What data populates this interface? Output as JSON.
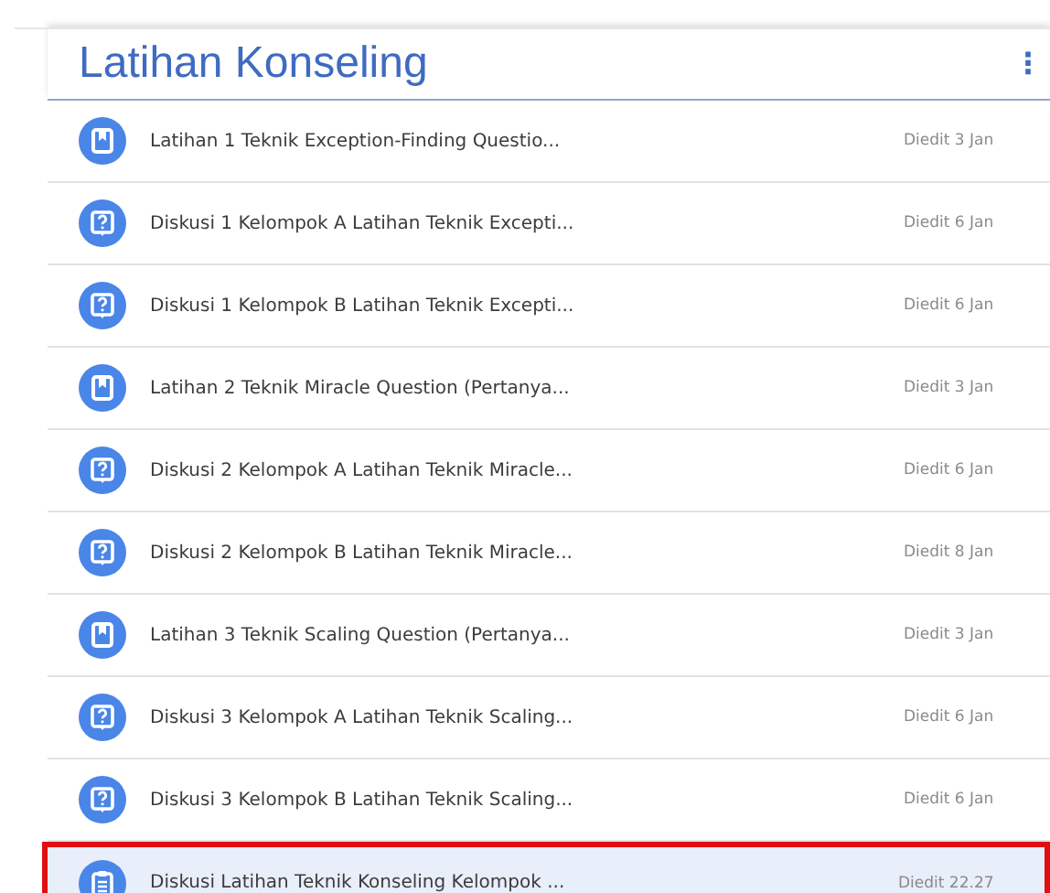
{
  "topic": {
    "title": "Latihan Konseling",
    "menu_icon": "⋮"
  },
  "items": [
    {
      "kind": "assignment",
      "title": "Latihan 1 Teknik Exception-Finding Questio...",
      "edited": "Diedit 3 Jan",
      "selected": false
    },
    {
      "kind": "question",
      "title": "Diskusi 1 Kelompok A Latihan Teknik Excepti...",
      "edited": "Diedit 6 Jan",
      "selected": false
    },
    {
      "kind": "question",
      "title": "Diskusi 1 Kelompok B Latihan Teknik Excepti...",
      "edited": "Diedit 6 Jan",
      "selected": false
    },
    {
      "kind": "assignment",
      "title": "Latihan 2 Teknik Miracle Question (Pertanya...",
      "edited": "Diedit 3 Jan",
      "selected": false
    },
    {
      "kind": "question",
      "title": "Diskusi 2 Kelompok A Latihan Teknik Miracle...",
      "edited": "Diedit 6 Jan",
      "selected": false
    },
    {
      "kind": "question",
      "title": "Diskusi 2 Kelompok B Latihan Teknik Miracle...",
      "edited": "Diedit 8 Jan",
      "selected": false
    },
    {
      "kind": "assignment",
      "title": "Latihan 3 Teknik Scaling Question (Pertanya...",
      "edited": "Diedit 3 Jan",
      "selected": false
    },
    {
      "kind": "question",
      "title": "Diskusi 3 Kelompok A Latihan Teknik Scaling...",
      "edited": "Diedit 6 Jan",
      "selected": false
    },
    {
      "kind": "question",
      "title": "Diskusi 3 Kelompok B Latihan Teknik Scaling...",
      "edited": "Diedit 6 Jan",
      "selected": false
    },
    {
      "kind": "material",
      "title": "Diskusi Latihan Teknik Konseling Kelompok ...",
      "edited": "Diedit 22.27",
      "selected": true
    }
  ]
}
